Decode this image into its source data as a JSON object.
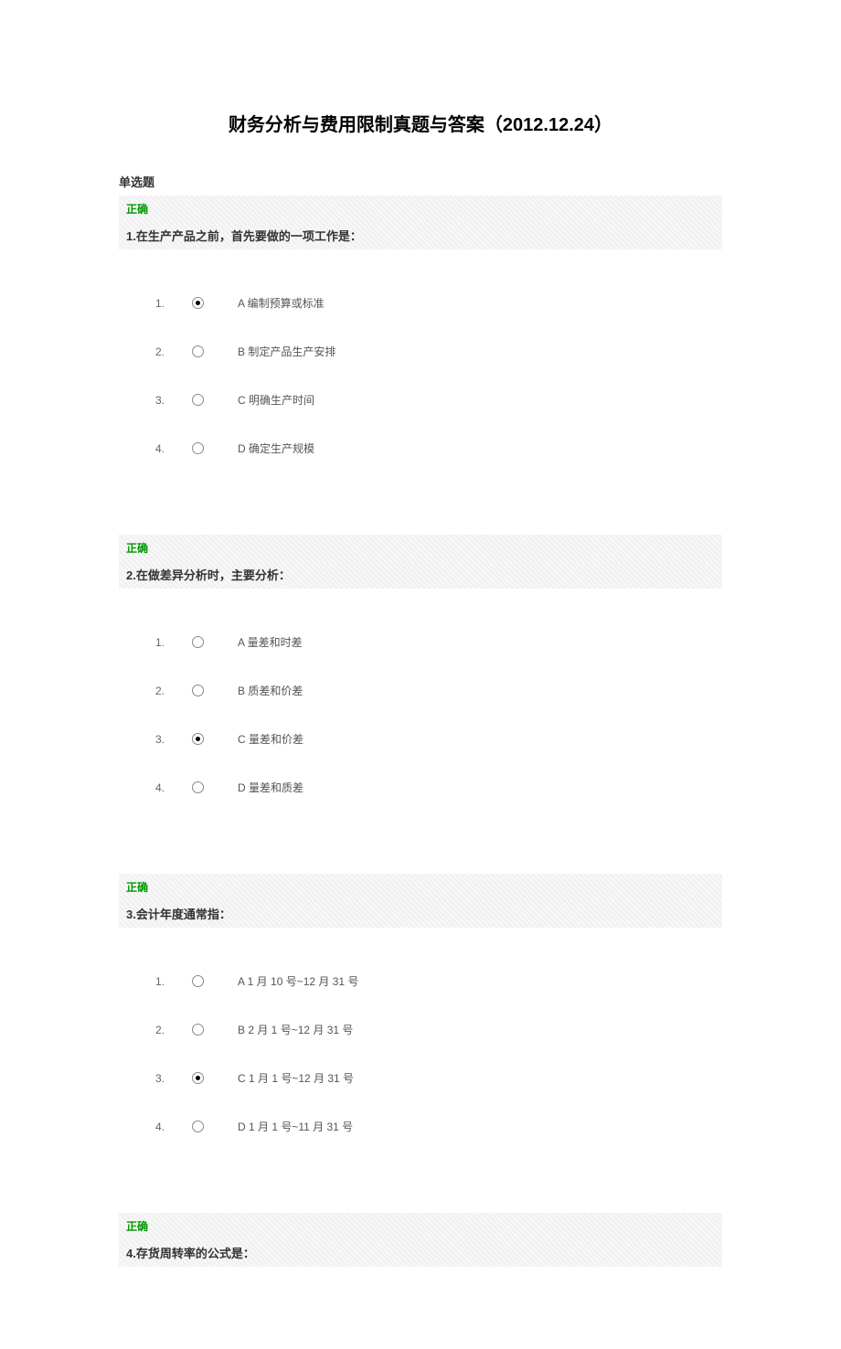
{
  "title": "财务分析与费用限制真题与答案（2012.12.24）",
  "section_heading": "单选题",
  "questions": [
    {
      "status": "正确",
      "text": "1.在生产产品之前，首先要做的一项工作是：",
      "selected": 0,
      "options": [
        {
          "num": "1.",
          "label": "A  编制预算或标准"
        },
        {
          "num": "2.",
          "label": "B  制定产品生产安排"
        },
        {
          "num": "3.",
          "label": "C  明确生产时间"
        },
        {
          "num": "4.",
          "label": "D  确定生产规模"
        }
      ]
    },
    {
      "status": "正确",
      "text": "2.在做差异分析时，主要分析：",
      "selected": 2,
      "options": [
        {
          "num": "1.",
          "label": "A  量差和时差"
        },
        {
          "num": "2.",
          "label": "B  质差和价差"
        },
        {
          "num": "3.",
          "label": "C  量差和价差"
        },
        {
          "num": "4.",
          "label": "D  量差和质差"
        }
      ]
    },
    {
      "status": "正确",
      "text": "3.会计年度通常指：",
      "selected": 2,
      "options": [
        {
          "num": "1.",
          "label": "A  1 月 10 号~12 月 31 号"
        },
        {
          "num": "2.",
          "label": "B  2 月 1 号~12 月 31 号"
        },
        {
          "num": "3.",
          "label": "C  1 月 1 号~12 月 31 号"
        },
        {
          "num": "4.",
          "label": "D  1 月 1 号~11 月 31 号"
        }
      ]
    },
    {
      "status": "正确",
      "text": "4.存货周转率的公式是：",
      "selected": -1,
      "options": []
    }
  ]
}
